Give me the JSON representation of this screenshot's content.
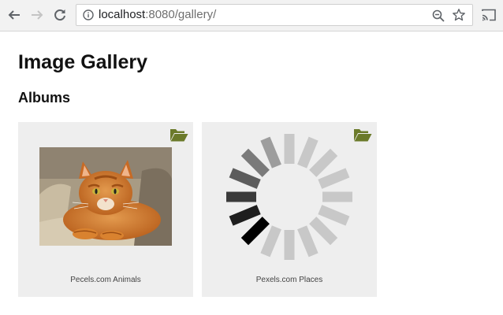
{
  "browser": {
    "address_host": "localhost",
    "address_rest": ":8080/gallery/",
    "icons": [
      "back-icon",
      "forward-icon",
      "reload-icon",
      "info-icon",
      "zoom-icon",
      "star-icon",
      "cast-icon"
    ]
  },
  "page": {
    "title": "Image Gallery",
    "section_title": "Albums"
  },
  "albums": [
    {
      "caption": "Pecels.com Animals",
      "thumbnail": "cat-photo",
      "state": "loaded"
    },
    {
      "caption": "Pexels.com Places",
      "thumbnail": "loading-spinner",
      "state": "loading"
    }
  ],
  "colors": {
    "folder_icon": "#6b7a2a",
    "card_background": "#eeeeee",
    "spinner_light": "#c8c8c8",
    "spinner_dark": "#000000"
  }
}
